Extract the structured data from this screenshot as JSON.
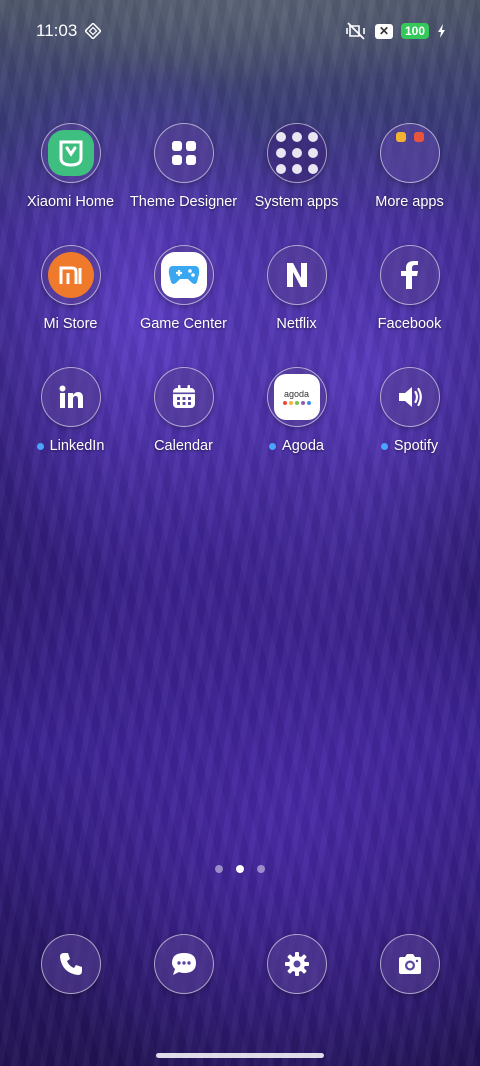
{
  "status_bar": {
    "time": "11:03",
    "battery": "100"
  },
  "apps": [
    [
      {
        "label": "Xiaomi Home",
        "icon": "xiaomi-home-icon",
        "dot": false
      },
      {
        "label": "Theme Designer",
        "icon": "theme-designer-icon",
        "dot": false
      },
      {
        "label": "System apps",
        "icon": "folder-icon",
        "dot": false
      },
      {
        "label": "More apps",
        "icon": "folder-icon",
        "dot": false
      }
    ],
    [
      {
        "label": "Mi Store",
        "icon": "mi-store-icon",
        "dot": false
      },
      {
        "label": "Game Center",
        "icon": "game-center-icon",
        "dot": false
      },
      {
        "label": "Netflix",
        "icon": "netflix-icon",
        "dot": false
      },
      {
        "label": "Facebook",
        "icon": "facebook-icon",
        "dot": false
      }
    ],
    [
      {
        "label": "LinkedIn",
        "icon": "linkedin-icon",
        "dot": true
      },
      {
        "label": "Calendar",
        "icon": "calendar-icon",
        "dot": false
      },
      {
        "label": "Agoda",
        "icon": "agoda-icon",
        "dot": true
      },
      {
        "label": "Spotify",
        "icon": "spotify-icon",
        "dot": true
      }
    ]
  ],
  "agoda_logo_text": "agoda",
  "pager": {
    "count": 3,
    "active": 1
  },
  "dock": [
    {
      "icon": "phone-icon"
    },
    {
      "icon": "messages-icon"
    },
    {
      "icon": "settings-icon"
    },
    {
      "icon": "camera-icon"
    }
  ],
  "colors": {
    "notification_dot": "#4aa3ff",
    "battery": "#34c759"
  }
}
